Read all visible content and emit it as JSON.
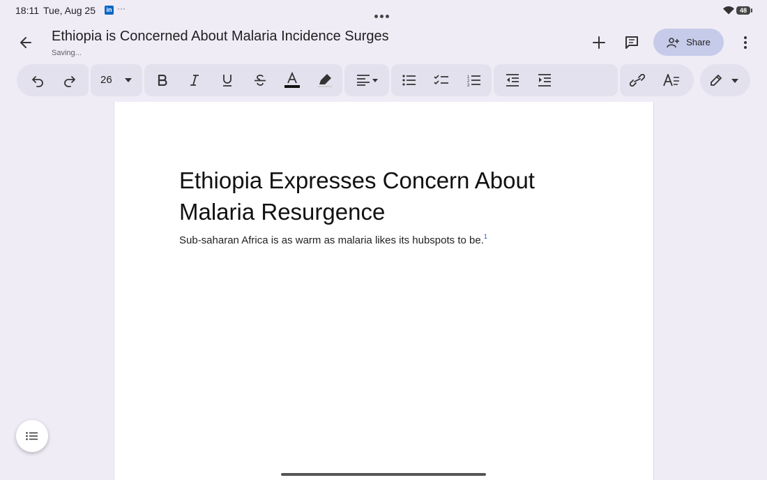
{
  "status_bar": {
    "time": "18:11",
    "date": "Tue, Aug 25",
    "app_badge": "in",
    "more": "···",
    "battery": "48"
  },
  "header": {
    "title": "Ethiopia is Concerned About Malaria Incidence Surges",
    "save_status": "Saving...",
    "share_label": "Share"
  },
  "toolbar": {
    "font_size": "26"
  },
  "document": {
    "heading": "Ethiopia Expresses Concern About Malaria Resurgence",
    "body": "Sub-saharan Africa is as warm as malaria likes its hubspots to be.",
    "footnote_ref": "1"
  },
  "colors": {
    "background": "#efecf6",
    "toolbar_group": "#e4e1ee",
    "share_button": "#c6cbe9",
    "text_color_underline": "#111111",
    "footnote_link": "#1a55c4"
  },
  "icons": [
    "back-arrow-icon",
    "plus-icon",
    "comment-icon",
    "person-add-icon",
    "more-vert-icon",
    "undo-icon",
    "redo-icon",
    "dropdown-arrow-icon",
    "bold-icon",
    "italic-icon",
    "underline-icon",
    "strikethrough-icon",
    "text-color-icon",
    "highlighter-icon",
    "align-left-icon",
    "bulleted-list-icon",
    "checklist-icon",
    "numbered-list-icon",
    "decrease-indent-icon",
    "increase-indent-icon",
    "link-icon",
    "text-style-icon",
    "edit-pencil-icon",
    "outline-list-icon"
  ]
}
